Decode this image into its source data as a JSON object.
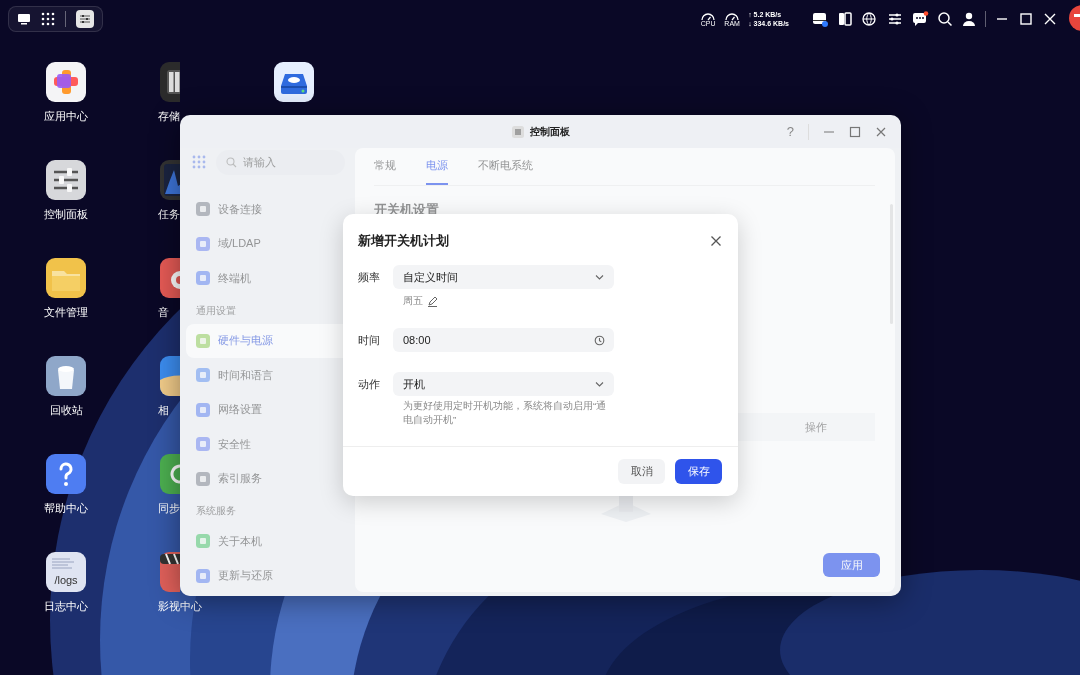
{
  "top_bar": {
    "cpu_label": "CPU",
    "ram_label": "RAM",
    "upload": "↑ 5.2 KB/s",
    "download": "↓ 334.6 KB/s"
  },
  "desktop_columns": [
    [
      {
        "kind": "appstore",
        "label": "应用中心"
      },
      {
        "kind": "sliders",
        "label": "控制面板"
      },
      {
        "kind": "folder",
        "label": "文件管理"
      },
      {
        "kind": "trash",
        "label": "回收站"
      },
      {
        "kind": "help",
        "label": "帮助中心"
      },
      {
        "kind": "logs",
        "label": "日志中心",
        "icon_text": "/logs"
      }
    ],
    [
      {
        "kind": "storage",
        "label": "存储"
      },
      {
        "kind": "chart",
        "label": "任务"
      },
      {
        "kind": "music",
        "label": "音"
      },
      {
        "label": "相"
      },
      {
        "kind": "sync",
        "label": "同步"
      },
      {
        "kind": "film",
        "label": "影视中心"
      }
    ],
    [
      {
        "kind": "drive"
      }
    ]
  ],
  "window": {
    "title": "控制面板",
    "help_label": "?",
    "sidebar": {
      "search": {
        "placeholder": "请输入"
      },
      "items": [
        {
          "kind": "item",
          "label": "设备连接",
          "selected": false
        },
        {
          "kind": "item",
          "label": "域/LDAP",
          "selected": false
        },
        {
          "kind": "item",
          "label": "终端机",
          "selected": false
        },
        {
          "kind": "heading",
          "label": "通用设置"
        },
        {
          "kind": "item",
          "label": "硬件与电源",
          "selected": true
        },
        {
          "kind": "item",
          "label": "时间和语言",
          "selected": false
        },
        {
          "kind": "item",
          "label": "网络设置",
          "selected": false
        },
        {
          "kind": "item",
          "label": "安全性",
          "selected": false
        },
        {
          "kind": "item",
          "label": "索引服务",
          "selected": false
        },
        {
          "kind": "heading",
          "label": "系统服务"
        },
        {
          "kind": "item",
          "label": "关于本机",
          "selected": false
        },
        {
          "kind": "item",
          "label": "更新与还原",
          "selected": false
        }
      ]
    },
    "tabs": [
      {
        "label": "常规",
        "selected": false
      },
      {
        "label": "电源",
        "selected": true
      },
      {
        "label": "不断电系统",
        "selected": false
      }
    ],
    "section_title": "开关机设置",
    "table": {
      "columns": [
        {
          "label": "操作"
        }
      ]
    },
    "apply_button": "应用"
  },
  "dialog": {
    "title": "新增开关机计划",
    "fields": [
      {
        "kind": "select",
        "label": "频率",
        "value": "自定义时间",
        "note": "周五"
      },
      {
        "kind": "time",
        "label": "时间",
        "value": "08:00"
      },
      {
        "kind": "select",
        "label": "动作",
        "value": "开机",
        "hint": "为更好使用定时开机功能，系统将自动启用“通电自动开机”"
      }
    ],
    "buttons": [
      {
        "kind": "secondary",
        "label": "取消"
      },
      {
        "kind": "primary",
        "label": "保存"
      }
    ]
  }
}
